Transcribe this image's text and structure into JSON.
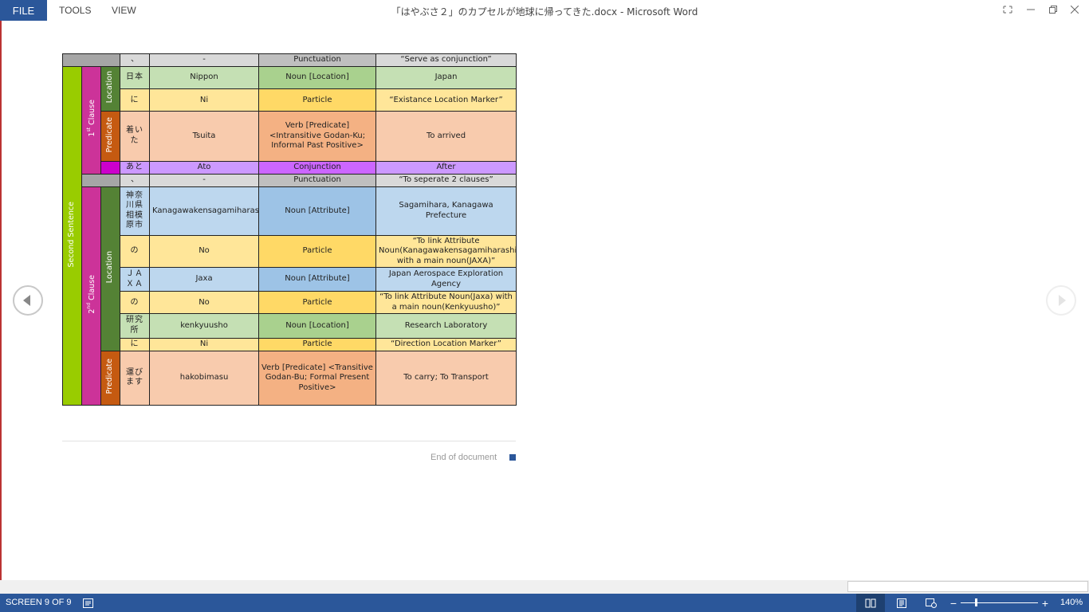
{
  "menu": {
    "file": "FILE",
    "tools": "TOOLS",
    "view": "VIEW"
  },
  "window": {
    "title": "「はやぶさ２」のカプセルが地球に帰ってきた.docx - Microsoft Word"
  },
  "colors": {
    "accent": "#2b579a",
    "gray": "#bfbfbf",
    "green_light": "#c5e0b4",
    "green_mid": "#a9d18e",
    "green_dark": "#548235",
    "green_bright": "#99cc00",
    "yellow_light": "#ffe699",
    "yellow_mid": "#ffd966",
    "orange_light": "#f8cbad",
    "orange_mid": "#f4b183",
    "orange_dark": "#c55a11",
    "purple_light": "#cc99ff",
    "purple_mid": "#cc66ff",
    "magenta": "#cc00cc",
    "pink": "#cc3399",
    "blue_light": "#bdd7ee",
    "blue_mid": "#9dc3e6"
  },
  "labels": {
    "second_sentence": "Second Sentence",
    "clause1": "1",
    "clause1_sup": "st",
    "clause1_rest": " Clause",
    "clause2": "2",
    "clause2_sup": "nd",
    "clause2_rest": " Clause",
    "location": "Location",
    "predicate": "Predicate"
  },
  "rows": [
    {
      "word": "、",
      "romaji": "-",
      "pos": "Punctuation",
      "meaning": "“Serve as conjunction”"
    },
    {
      "word": "日本",
      "romaji": "Nippon",
      "pos": "Noun [Location]",
      "meaning": "Japan"
    },
    {
      "word": "に",
      "romaji": "Ni",
      "pos": "Particle",
      "meaning": "“Existance Location Marker”"
    },
    {
      "word": "着いた",
      "romaji": "Tsuita",
      "pos": "Verb [Predicate] <Intransitive Godan-Ku; Informal Past Positive>",
      "meaning": "To arrived"
    },
    {
      "word": "あと",
      "romaji": "Ato",
      "pos": "Conjunction",
      "meaning": "After"
    },
    {
      "word": "、",
      "romaji": "-",
      "pos": "Punctuation",
      "meaning": "“To seperate 2 clauses”"
    },
    {
      "word": "神奈川県相模原市",
      "romaji": "Kanagawakensagamiharashi",
      "pos": "Noun [Attribute]",
      "meaning": "Sagamihara, Kanagawa Prefecture"
    },
    {
      "word": "の",
      "romaji": "No",
      "pos": "Particle",
      "meaning": "“To link Attribute Noun(Kanagawakensagamiharashi) with a main noun(JAXA)”"
    },
    {
      "word": "ＪＡＸＡ",
      "romaji": "Jaxa",
      "pos": "Noun [Attribute]",
      "meaning": "Japan Aerospace Exploration Agency"
    },
    {
      "word": "の",
      "romaji": "No",
      "pos": "Particle",
      "meaning": "“To link Attribute Noun(Jaxa) with a main noun(Kenkyuusho)”"
    },
    {
      "word": "研究所",
      "romaji": "kenkyuusho",
      "pos": "Noun [Location]",
      "meaning": "Research Laboratory"
    },
    {
      "word": "に",
      "romaji": "Ni",
      "pos": "Particle",
      "meaning": "“Direction Location Marker”"
    },
    {
      "word": "運びます",
      "romaji": "hakobimasu",
      "pos": "Verb [Predicate] <Transitive Godan-Bu; Formal Present Positive>",
      "meaning": "To carry; To Transport"
    }
  ],
  "end_of_document": "End of document",
  "status": {
    "screen": "SCREEN 9 OF 9",
    "zoom": "140%"
  }
}
